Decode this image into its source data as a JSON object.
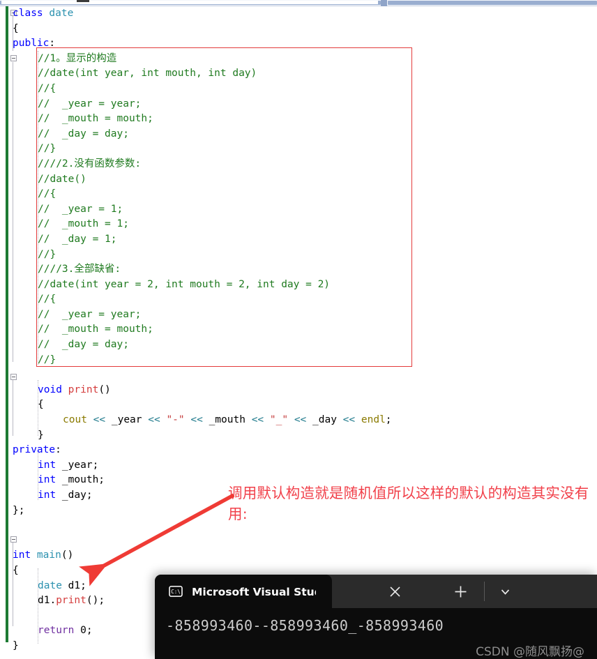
{
  "editor": {
    "language": "cpp",
    "change_bar_color": "#1d7a33",
    "lines": [
      {
        "indent": 0,
        "segs": [
          {
            "t": "class ",
            "c": "kw"
          },
          {
            "t": "date",
            "c": "typ"
          }
        ]
      },
      {
        "indent": 0,
        "segs": [
          {
            "t": "{",
            "c": "var"
          }
        ]
      },
      {
        "indent": 0,
        "segs": [
          {
            "t": "public",
            "c": "kw"
          },
          {
            "t": ":",
            "c": "var"
          }
        ]
      },
      {
        "indent": 1,
        "segs": [
          {
            "t": "//1。显示的构造",
            "c": "cmt"
          }
        ]
      },
      {
        "indent": 1,
        "segs": [
          {
            "t": "//date(int year, int mouth, int day)",
            "c": "cmt"
          }
        ]
      },
      {
        "indent": 1,
        "segs": [
          {
            "t": "//{",
            "c": "cmt"
          }
        ]
      },
      {
        "indent": 1,
        "segs": [
          {
            "t": "//  _year = year;",
            "c": "cmt"
          }
        ]
      },
      {
        "indent": 1,
        "segs": [
          {
            "t": "//  _mouth = mouth;",
            "c": "cmt"
          }
        ]
      },
      {
        "indent": 1,
        "segs": [
          {
            "t": "//  _day = day;",
            "c": "cmt"
          }
        ]
      },
      {
        "indent": 1,
        "segs": [
          {
            "t": "//}",
            "c": "cmt"
          }
        ]
      },
      {
        "indent": 1,
        "segs": [
          {
            "t": "////2.没有函数参数:",
            "c": "cmt"
          }
        ]
      },
      {
        "indent": 1,
        "segs": [
          {
            "t": "//date()",
            "c": "cmt"
          }
        ]
      },
      {
        "indent": 1,
        "segs": [
          {
            "t": "//{",
            "c": "cmt"
          }
        ]
      },
      {
        "indent": 1,
        "segs": [
          {
            "t": "//  _year = 1;",
            "c": "cmt"
          }
        ]
      },
      {
        "indent": 1,
        "segs": [
          {
            "t": "//  _mouth = 1;",
            "c": "cmt"
          }
        ]
      },
      {
        "indent": 1,
        "segs": [
          {
            "t": "//  _day = 1;",
            "c": "cmt"
          }
        ]
      },
      {
        "indent": 1,
        "segs": [
          {
            "t": "//}",
            "c": "cmt"
          }
        ]
      },
      {
        "indent": 1,
        "segs": [
          {
            "t": "////3.全部缺省:",
            "c": "cmt"
          }
        ]
      },
      {
        "indent": 1,
        "segs": [
          {
            "t": "//date(int year = 2, int mouth = 2, int day = 2)",
            "c": "cmt"
          }
        ]
      },
      {
        "indent": 1,
        "segs": [
          {
            "t": "//{",
            "c": "cmt"
          }
        ]
      },
      {
        "indent": 1,
        "segs": [
          {
            "t": "//  _year = year;",
            "c": "cmt"
          }
        ]
      },
      {
        "indent": 1,
        "segs": [
          {
            "t": "//  _mouth = mouth;",
            "c": "cmt"
          }
        ]
      },
      {
        "indent": 1,
        "segs": [
          {
            "t": "//  _day = day;",
            "c": "cmt"
          }
        ]
      },
      {
        "indent": 1,
        "segs": [
          {
            "t": "//}",
            "c": "cmt"
          }
        ]
      },
      {
        "indent": 0,
        "segs": []
      },
      {
        "indent": 1,
        "segs": [
          {
            "t": "void ",
            "c": "kw"
          },
          {
            "t": "print",
            "c": "fn"
          },
          {
            "t": "()",
            "c": "var"
          }
        ]
      },
      {
        "indent": 1,
        "segs": [
          {
            "t": "{",
            "c": "var"
          }
        ]
      },
      {
        "indent": 2,
        "segs": [
          {
            "t": "cout ",
            "c": "pp"
          },
          {
            "t": "<< ",
            "c": "op"
          },
          {
            "t": "_year ",
            "c": "var"
          },
          {
            "t": "<< ",
            "c": "op"
          },
          {
            "t": "\"-\" ",
            "c": "str"
          },
          {
            "t": "<< ",
            "c": "op"
          },
          {
            "t": "_mouth ",
            "c": "var"
          },
          {
            "t": "<< ",
            "c": "op"
          },
          {
            "t": "\"_\" ",
            "c": "str"
          },
          {
            "t": "<< ",
            "c": "op"
          },
          {
            "t": "_day ",
            "c": "var"
          },
          {
            "t": "<< ",
            "c": "op"
          },
          {
            "t": "endl",
            "c": "pp"
          },
          {
            "t": ";",
            "c": "var"
          }
        ]
      },
      {
        "indent": 1,
        "segs": [
          {
            "t": "}",
            "c": "var"
          }
        ]
      },
      {
        "indent": 0,
        "segs": [
          {
            "t": "private",
            "c": "kw"
          },
          {
            "t": ":",
            "c": "var"
          }
        ]
      },
      {
        "indent": 1,
        "segs": [
          {
            "t": "int ",
            "c": "kw"
          },
          {
            "t": "_year;",
            "c": "var"
          }
        ]
      },
      {
        "indent": 1,
        "segs": [
          {
            "t": "int ",
            "c": "kw"
          },
          {
            "t": "_mouth;",
            "c": "var"
          }
        ]
      },
      {
        "indent": 1,
        "segs": [
          {
            "t": "int ",
            "c": "kw"
          },
          {
            "t": "_day;",
            "c": "var"
          }
        ]
      },
      {
        "indent": 0,
        "segs": [
          {
            "t": "};",
            "c": "var"
          }
        ]
      },
      {
        "indent": 0,
        "segs": []
      },
      {
        "indent": 0,
        "segs": []
      },
      {
        "indent": 0,
        "segs": [
          {
            "t": "int ",
            "c": "kw"
          },
          {
            "t": "main",
            "c": "typ"
          },
          {
            "t": "()",
            "c": "var"
          }
        ]
      },
      {
        "indent": 0,
        "segs": [
          {
            "t": "{",
            "c": "var"
          }
        ]
      },
      {
        "indent": 1,
        "segs": [
          {
            "t": "date ",
            "c": "typ"
          },
          {
            "t": "d1;",
            "c": "var"
          }
        ]
      },
      {
        "indent": 1,
        "segs": [
          {
            "t": "d1.",
            "c": "var"
          },
          {
            "t": "print",
            "c": "fn"
          },
          {
            "t": "()",
            "c": "var"
          },
          {
            "t": ";",
            "c": "var"
          }
        ]
      },
      {
        "indent": 0,
        "segs": []
      },
      {
        "indent": 1,
        "segs": [
          {
            "t": "return ",
            "c": "pur"
          },
          {
            "t": "0",
            "c": "var"
          },
          {
            "t": ";",
            "c": "var"
          }
        ]
      },
      {
        "indent": 0,
        "segs": [
          {
            "t": "}",
            "c": "var"
          }
        ]
      }
    ]
  },
  "highlight_box": {
    "color": "#e33b3b",
    "label": "commented-constructor-variants"
  },
  "annotation": {
    "text": "调用默认构造就是随机值所以这样的默认的构造其实没有用:",
    "color": "#f1404a"
  },
  "arrow": {
    "color": "#ef3b35",
    "label": "points-to-date-d1-declaration"
  },
  "console": {
    "tab_title": "Microsoft Visual Studio 调试控",
    "tab_icon": "console-cmd-icon",
    "close_label": "✕",
    "new_tab_label": "+",
    "dropdown_label": "⌄",
    "output": "-858993460--858993460_-858993460",
    "watermark": "CSDN @随风飘扬@",
    "background": "#0c0c0c"
  }
}
